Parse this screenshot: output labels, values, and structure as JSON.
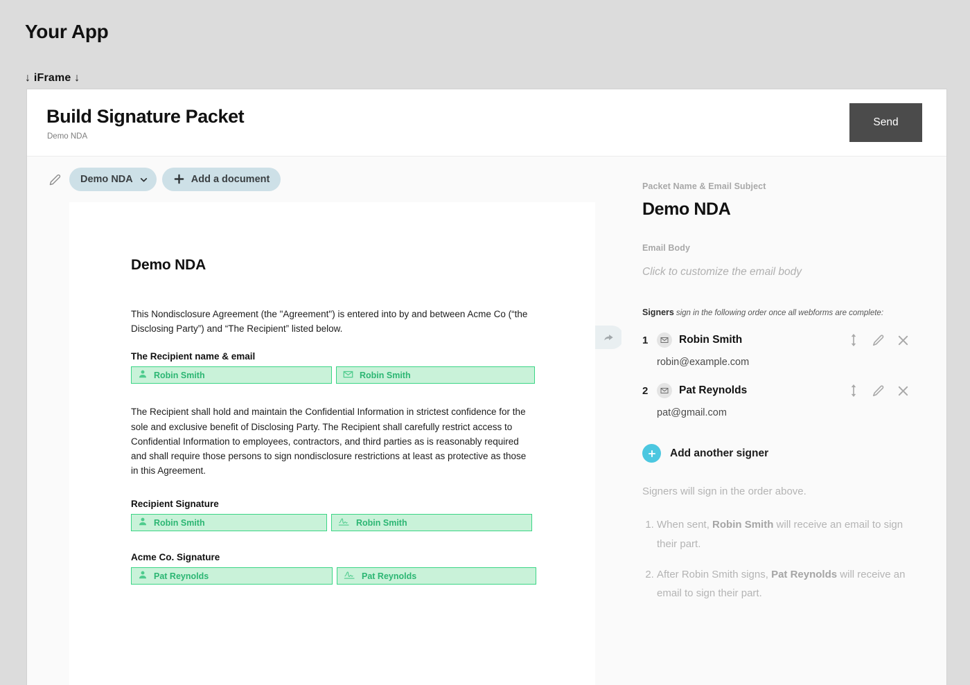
{
  "host": {
    "app_title": "Your App",
    "iframe_label": "↓ iFrame ↓"
  },
  "header": {
    "title": "Build Signature Packet",
    "subtitle": "Demo NDA",
    "send_label": "Send"
  },
  "toolbar": {
    "edit_icon": "pencil-icon",
    "document_pill_label": "Demo NDA",
    "add_document_label": "Add a document",
    "undo_icon": "undo-arrow-icon",
    "redo_icon": "redo-arrow-icon"
  },
  "document": {
    "title": "Demo NDA",
    "paragraph_1": "This Nondisclosure Agreement (the \"Agreement\") is entered into by and between Acme Co (“the Disclosing Party”) and “The Recipient” listed below.",
    "paragraph_2": "The Recipient shall hold and maintain the Confidential Information in strictest confidence for the sole and exclusive benefit of Disclosing Party. The Recipient shall carefully restrict access to Confidential Information to employees, contractors, and third parties as is reasonably required and shall require those persons to sign nondisclosure restrictions at least as protective as those in this Agreement.",
    "sections": [
      {
        "label": "The Recipient name & email",
        "fields": [
          {
            "icon": "person-icon",
            "value": "Robin Smith"
          },
          {
            "icon": "envelope-icon",
            "value": "Robin Smith"
          }
        ]
      },
      {
        "label": "Recipient Signature",
        "fields": [
          {
            "icon": "person-icon",
            "value": "Robin Smith"
          },
          {
            "icon": "signature-icon",
            "value": "Robin Smith"
          }
        ]
      },
      {
        "label": "Acme Co. Signature",
        "fields": [
          {
            "icon": "person-icon",
            "value": "Pat Reynolds"
          },
          {
            "icon": "signature-icon",
            "value": "Pat Reynolds"
          }
        ]
      }
    ]
  },
  "panel": {
    "packet_name_label": "Packet Name & Email Subject",
    "packet_name_value": "Demo NDA",
    "email_body_label": "Email Body",
    "email_body_placeholder": "Click to customize the email body",
    "signers_heading": "Signers",
    "signers_hint": "sign in the following order once all webforms are complete:",
    "signers": [
      {
        "number": "1",
        "name": "Robin Smith",
        "email": "robin@example.com"
      },
      {
        "number": "2",
        "name": "Pat Reynolds",
        "email": "pat@gmail.com"
      }
    ],
    "add_signer_label": "Add another signer",
    "order_note": "Signers will sign in the order above.",
    "steps": [
      {
        "prefix": "When sent, ",
        "bold": "Robin Smith",
        "suffix": " will receive an email to sign their part."
      },
      {
        "prefix": "After Robin Smith signs, ",
        "bold": "Pat Reynolds",
        "suffix": " will receive an email to sign their part."
      }
    ]
  },
  "colors": {
    "page_background": "#dcdcdc",
    "send_button": "#4b4b4b",
    "pill": "#cde0e7",
    "field_background": "#c9f2d9",
    "field_border": "#3ad585",
    "field_text": "#2cb673",
    "add_signer_circle": "#4cc7e0"
  }
}
